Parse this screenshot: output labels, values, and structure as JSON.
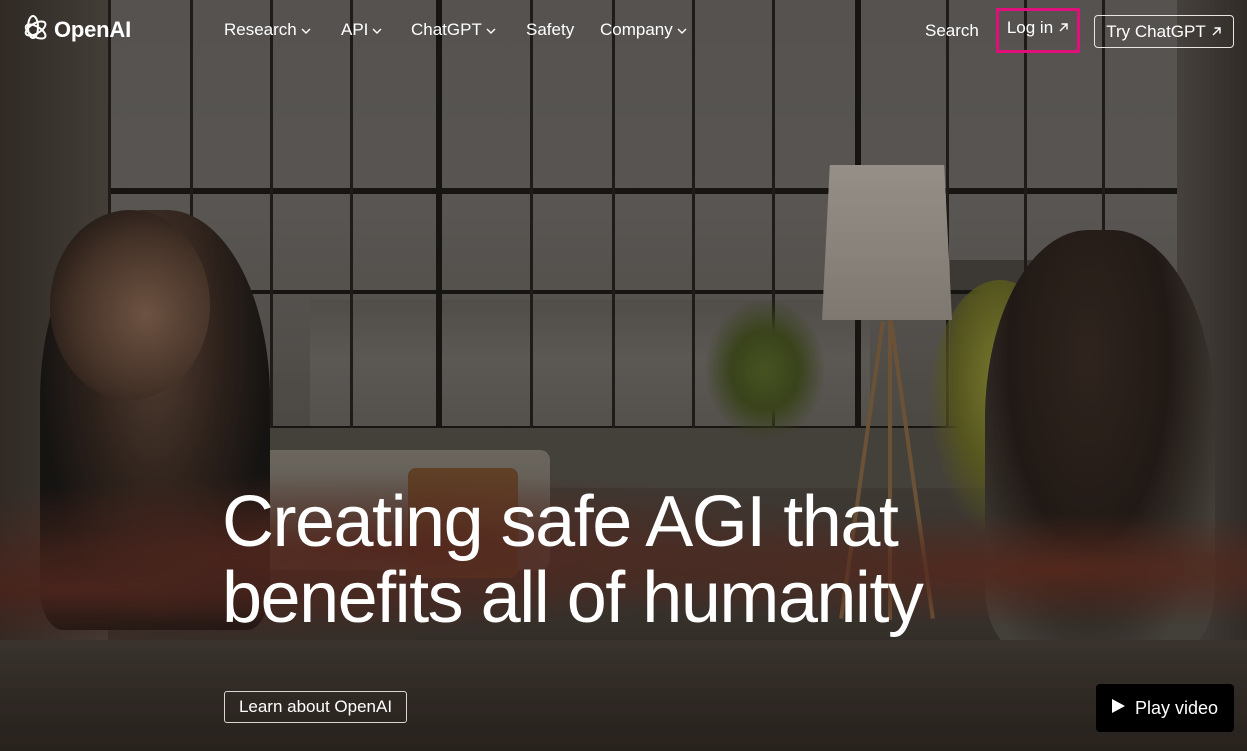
{
  "brand": {
    "name": "OpenAI",
    "logo_icon": "openai-blossom-icon"
  },
  "nav": {
    "items": [
      {
        "label": "Research",
        "has_dropdown": true
      },
      {
        "label": "API",
        "has_dropdown": true
      },
      {
        "label": "ChatGPT",
        "has_dropdown": true
      },
      {
        "label": "Safety",
        "has_dropdown": false
      },
      {
        "label": "Company",
        "has_dropdown": true
      }
    ],
    "search_label": "Search",
    "login_label": "Log in",
    "try_label": "Try ChatGPT",
    "external_icon": "arrow-up-right-icon"
  },
  "hero": {
    "title_line1": "Creating safe AGI that",
    "title_line2": "benefits all of humanity",
    "learn_label": "Learn about OpenAI",
    "play_label": "Play video",
    "play_icon": "play-icon"
  },
  "colors": {
    "highlight_border": "#e0107a",
    "text": "#ffffff",
    "play_button_bg": "#000000"
  }
}
